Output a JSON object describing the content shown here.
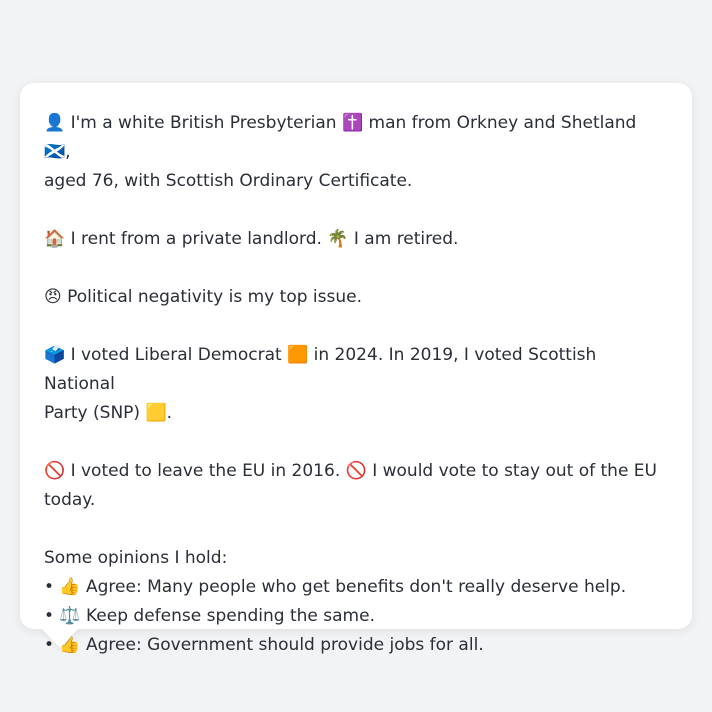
{
  "message": {
    "identity": {
      "line1": "👤 I'm a white British Presbyterian ✝️ man from Orkney and Shetland 🏴󠁧󠁢󠁳󠁣󠁴󠁿,",
      "line2": "aged 76, with Scottish Ordinary Certificate."
    },
    "housing": "🏠 I rent from a private landlord. 🌴 I am retired.",
    "top_issue": "😠 Political negativity is my top issue.",
    "voting": {
      "line1": "🗳️ I voted Liberal Democrat 🟧 in 2024. In 2019, I voted Scottish National",
      "line2": "Party (SNP) 🟨."
    },
    "eu": {
      "line1": "🚫 I voted to leave the EU in 2016. 🚫 I would vote to stay out of the EU",
      "line2": "today."
    },
    "opinions": {
      "heading": "Some opinions I hold:",
      "items": [
        "• 👍 Agree: Many people who get benefits don't really deserve help.",
        "• ⚖️ Keep defense spending the same.",
        "• 👍 Agree: Government should provide jobs for all."
      ]
    }
  }
}
